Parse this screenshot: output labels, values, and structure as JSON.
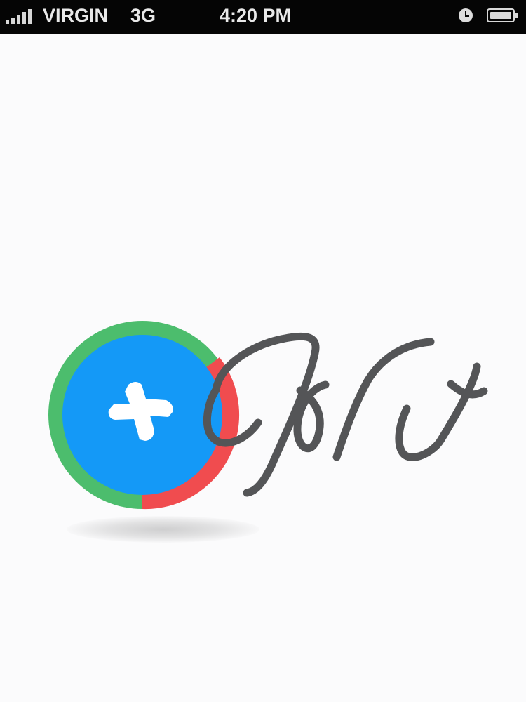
{
  "status_bar": {
    "carrier": "VIRGIN",
    "network": "3G",
    "time": "4:20 PM",
    "signal_bars": 5,
    "icons": [
      "signal-icon",
      "clock-icon",
      "battery-icon"
    ]
  },
  "logo": {
    "icon": "plus-icon",
    "wordmark": "Jole",
    "colors": {
      "ring_green": "#4cbd6d",
      "ring_red": "#f04c4f",
      "inner_blue": "#1499f7",
      "plus": "#ffffff",
      "wordmark": "#545557"
    }
  }
}
